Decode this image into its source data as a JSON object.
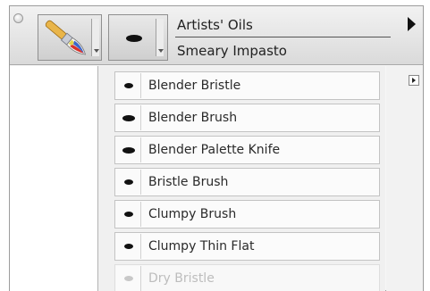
{
  "header": {
    "category_name": "Artists' Oils",
    "variant_name": "Smeary Impasto"
  },
  "icons": {
    "category_icon": "paintbrush-icon",
    "variant_icon": "brush-dab-icon",
    "palette_menu": "triangle-right-icon",
    "flyout": "play-icon",
    "close": "close-circle-icon"
  },
  "variant_list": {
    "items": [
      {
        "label": "Blender Bristle",
        "dab": "small"
      },
      {
        "label": "Blender Brush",
        "dab": "large"
      },
      {
        "label": "Blender Palette Knife",
        "dab": "large"
      },
      {
        "label": "Bristle Brush",
        "dab": "small"
      },
      {
        "label": "Clumpy Brush",
        "dab": "small"
      },
      {
        "label": "Clumpy Thin Flat",
        "dab": "small"
      },
      {
        "label": "Dry Bristle",
        "dab": "small",
        "faded": true
      }
    ]
  }
}
